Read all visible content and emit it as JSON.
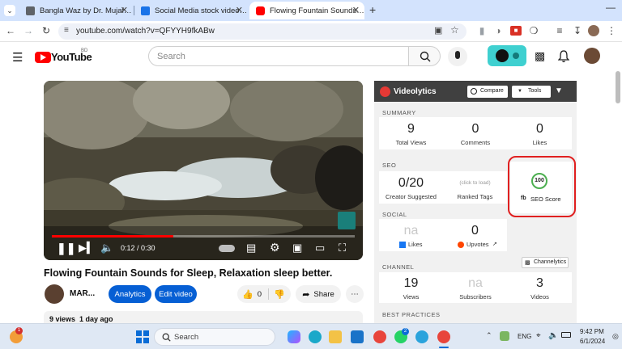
{
  "browser": {
    "tabs": [
      {
        "title": "Bangla Waz by Dr. Mujaffar",
        "active": false,
        "color": "#5f6368"
      },
      {
        "title": "Social Media stock videos for f…",
        "active": false,
        "color": "#1a73e8"
      },
      {
        "title": "Flowing Fountain Sounds for Sl…",
        "active": true,
        "color": "#ff0000"
      }
    ],
    "new_tab": "+",
    "url": "youtube.com/watch?v=QFYYH9fkABw"
  },
  "youtube": {
    "logo_text": "YouTube",
    "region": "BD",
    "search_placeholder": "Search",
    "video": {
      "current_time": "0:12 / 0:30",
      "progress": 0.4,
      "title": "Flowing Fountain Sounds for Sleep, Relaxation sleep better.",
      "channel": "MAR...",
      "analytics_label": "Analytics",
      "edit_label": "Edit video",
      "likes": "0",
      "share_label": "Share",
      "views_line": "9 views  1 day ago"
    }
  },
  "videolytics": {
    "brand": "Videolytics",
    "compare_label": "Compare",
    "tools_label": "Tools",
    "summary_label": "SUMMARY",
    "summary": [
      {
        "value": "9",
        "label": "Total Views"
      },
      {
        "value": "0",
        "label": "Comments"
      },
      {
        "value": "0",
        "label": "Likes"
      }
    ],
    "seo_label": "SEO",
    "seo_creator_value": "0/20",
    "seo_creator_label": "Creator Suggested",
    "seo_click_hint": "(click to load)",
    "seo_ranked_label": "Ranked Tags",
    "seo_score": "100",
    "seo_score_label": "SEO Score",
    "social_label": "SOCIAL",
    "social_fb_value": "na",
    "social_fb_label": "Likes",
    "social_upvotes_value": "0",
    "social_upvotes_label": "Upvotes",
    "channel_label": "CHANNEL",
    "channelytics_label": "Channelytics",
    "channel_stats": [
      {
        "value": "19",
        "label": "Views"
      },
      {
        "value": "na",
        "label": "Subscribers"
      },
      {
        "value": "3",
        "label": "Videos"
      }
    ],
    "best_practices_label": "BEST PRACTICES"
  },
  "taskbar": {
    "search_placeholder": "Search",
    "language": "ENG",
    "time": "9:42 PM",
    "date": "6/1/2024",
    "whatsapp_badge": "2",
    "weather_badge": "1"
  }
}
